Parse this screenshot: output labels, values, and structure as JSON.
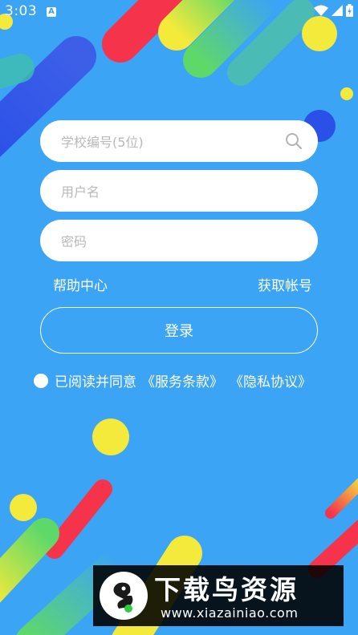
{
  "status_bar": {
    "time": "3:03"
  },
  "form": {
    "school_code_placeholder": "学校编号(5位)",
    "username_placeholder": "用户名",
    "password_placeholder": "密码"
  },
  "links": {
    "help": "帮助中心",
    "get_account": "获取帐号"
  },
  "login_label": "登录",
  "agreement": {
    "text": "已阅读并同意",
    "terms": "《服务条款》",
    "privacy": "《隐私协议》"
  },
  "watermark": {
    "title": "下载鸟资源",
    "url": "www.xiazainiao.com"
  },
  "colors": {
    "background": "#3ba4f5",
    "field_bg": "#ffffff",
    "placeholder": "#b9b9b9",
    "deco_red": "#f5344c",
    "deco_yellow": "#f4ea3b",
    "deco_green": "#5fd86a",
    "deco_blue": "#2b50e8"
  }
}
